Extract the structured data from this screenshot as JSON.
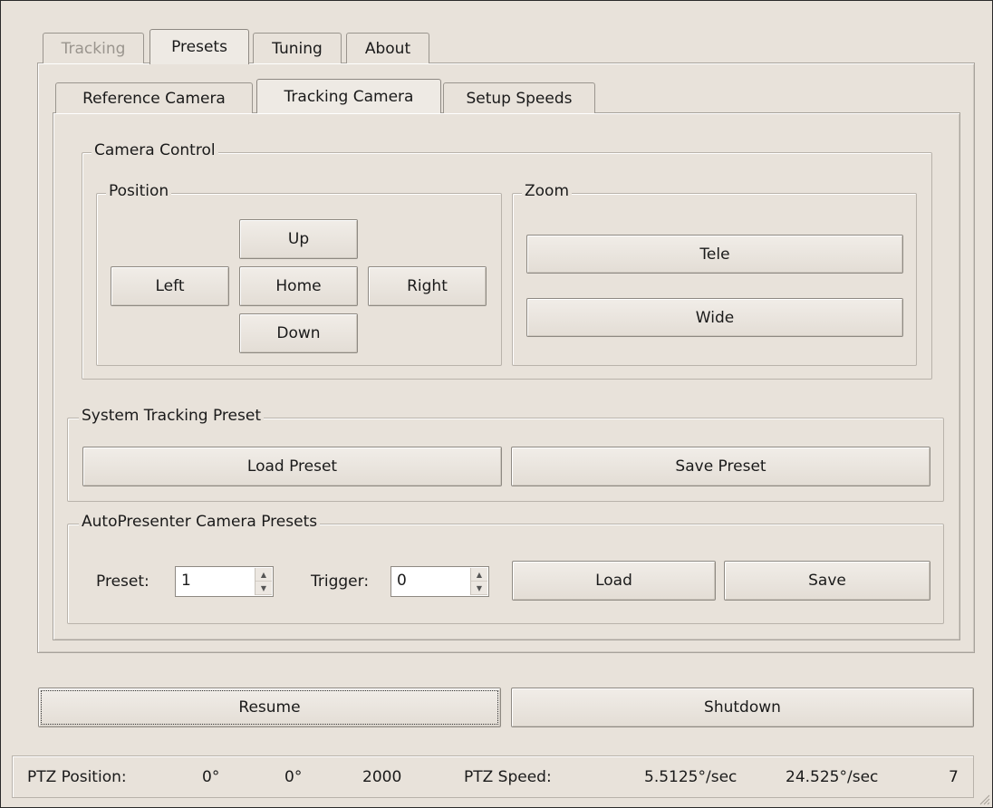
{
  "main_tabs": [
    {
      "label": "Tracking",
      "state": "disabled"
    },
    {
      "label": "Presets",
      "state": "active"
    },
    {
      "label": "Tuning",
      "state": "normal"
    },
    {
      "label": "About",
      "state": "normal"
    }
  ],
  "sub_tabs": [
    {
      "label": "Reference Camera",
      "state": "normal"
    },
    {
      "label": "Tracking Camera",
      "state": "active"
    },
    {
      "label": "Setup Speeds",
      "state": "normal"
    }
  ],
  "camera_control": {
    "title": "Camera Control",
    "position": {
      "title": "Position",
      "up": "Up",
      "left": "Left",
      "home": "Home",
      "right": "Right",
      "down": "Down"
    },
    "zoom": {
      "title": "Zoom",
      "tele": "Tele",
      "wide": "Wide"
    }
  },
  "system_tracking_preset": {
    "title": "System Tracking Preset",
    "load": "Load Preset",
    "save": "Save Preset"
  },
  "autopresenter": {
    "title": "AutoPresenter Camera Presets",
    "preset_label": "Preset:",
    "preset_value": "1",
    "trigger_label": "Trigger:",
    "trigger_value": "0",
    "load": "Load",
    "save": "Save"
  },
  "bottom_buttons": {
    "resume": "Resume",
    "shutdown": "Shutdown"
  },
  "status": {
    "ptz_position_label": "PTZ Position:",
    "pan": "0°",
    "tilt": "0°",
    "zoom": "2000",
    "ptz_speed_label": "PTZ Speed:",
    "pan_speed": "5.5125°/sec",
    "tilt_speed": "24.525°/sec",
    "zoom_speed": "7"
  }
}
